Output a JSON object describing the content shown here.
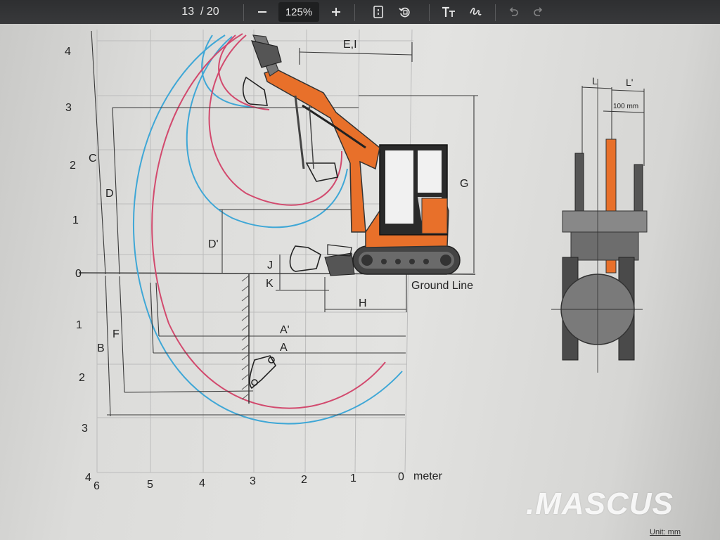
{
  "toolbar": {
    "current_page": "13",
    "page_separator": "/",
    "total_pages": "20",
    "zoom": "125%",
    "tools": [
      {
        "name": "zoom-out",
        "icon": "minus-icon"
      },
      {
        "name": "zoom-in",
        "icon": "plus-icon"
      },
      {
        "name": "fit-page",
        "icon": "fit-page-icon"
      },
      {
        "name": "rotate",
        "icon": "rotate-icon"
      },
      {
        "name": "text",
        "icon": "text-size-icon"
      },
      {
        "name": "draw",
        "icon": "draw-icon"
      },
      {
        "name": "undo",
        "icon": "undo-icon"
      },
      {
        "name": "redo",
        "icon": "redo-icon"
      }
    ]
  },
  "diagram": {
    "y_ticks": [
      "4",
      "3",
      "2",
      "1",
      "0",
      "1",
      "2",
      "3",
      "4"
    ],
    "x_ticks": [
      "6",
      "5",
      "4",
      "3",
      "2",
      "1",
      "0"
    ],
    "x_unit": "meter",
    "ground_label": "Ground Line",
    "dimension_labels": {
      "C": "C",
      "D": "D",
      "D_prime": "D'",
      "B": "B",
      "F": "F",
      "A": "A",
      "A_prime": "A'",
      "E_I": "E,I",
      "G": "G",
      "H": "H",
      "J": "J",
      "K": "K"
    },
    "front_view": {
      "L": "L",
      "L_prime": "L'",
      "gap_label": "100 mm"
    },
    "colors": {
      "arc_blue": "#3fa7d6",
      "arc_pink": "#d24a6e",
      "machine_orange": "#e8702a",
      "grid": "#b9b9b9"
    }
  },
  "watermark": ".MASCUS",
  "unit_note": "Unit: mm"
}
